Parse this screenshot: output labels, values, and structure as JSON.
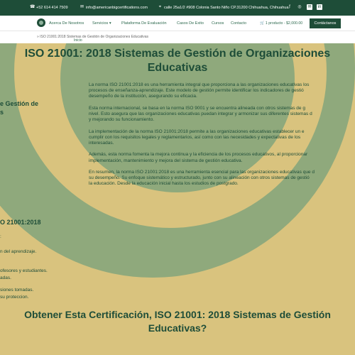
{
  "topbar": {
    "phone": "+52 614 414 7509",
    "email": "info@americanbigcertifications.com",
    "address": "calle 25a1/2 #908 Colonia Santo Niño CP.31200 Chihuahua, Chihuahua.",
    "social_icons": [
      "facebook-icon",
      "instagram-icon",
      "email-icon",
      "linkedin-icon"
    ],
    "bg_color": "#1e4d38"
  },
  "nav": {
    "items": [
      "Acerca De Nosotros",
      "Servicios",
      "Plataforma De Evaluación",
      "Casos De Exito",
      "Cursos",
      "Contacto"
    ],
    "cart": "1 producto - $2,000.00",
    "cta": "Contáctanos"
  },
  "breadcrumb": {
    "home": "Inicio",
    "separator": "»",
    "current": "ISO 21001:2018 Sistemas de Gestión de Organizaciones Educativas"
  },
  "main": {
    "title_line1": "ISO 21001: 2018 Sistemas de Gestión de Organizaciones",
    "title_line2": "Educativas",
    "side_heading_line1": "e Gestión de",
    "side_heading_line2": "s",
    "side_heading2": "O 21001:2018",
    "side_list": [
      ":",
      "n del aprendizaje.",
      "ofesores y estudiantes.",
      "adas.",
      "siones tomadas.",
      "su proteccion."
    ],
    "paragraphs": [
      [
        "La norma ISO 21001:2018 es una herramienta integral que proporciona a las organizaciones educativas los",
        "procesos de enseñanza-aprendizaje. Este modelo de gestión permite identificar los indicadores de gestió",
        "desempeño de la institución, asegurando su eficacia."
      ],
      [
        "Esta norma internacional, se basa en la norma ISO 9001 y se encuentra alineada con otros sistemas de g",
        "nivel. Esto asegura que las organizaciones educativas puedan integrar y armonizar sus diferentes sistemas d",
        "y mejorando su funcionamiento."
      ],
      [
        "La implementación de la norma ISO 21001:2018 permite a las organizaciones educativas establecer un e",
        "cumplir con los requisitos legales y reglamentarios, así como con las necesidades y expectativas de los",
        "interesadas."
      ],
      [
        "Además, esta norma fomenta la mejora continua y la eficiencia de los procesos educativos, al proporcionar",
        "implementación, mantenimiento y mejora del sistema de gestión educativa."
      ],
      [
        "En resumen, la norma ISO 21001:2018 es una herramienta esencial para las organizaciones educativas que d",
        "su desempeño. Su enfoque sistemático y estructurado, junto con su alineación con otros sistemas de gestió",
        "la educación. Desde la educación inicial hasta los estudios de postgrado."
      ]
    ],
    "bottom_line1": "Obtener Esta Certificación, ISO 21001: 2018 Sistemas de Gestión",
    "bottom_line2": "Educativas?"
  }
}
